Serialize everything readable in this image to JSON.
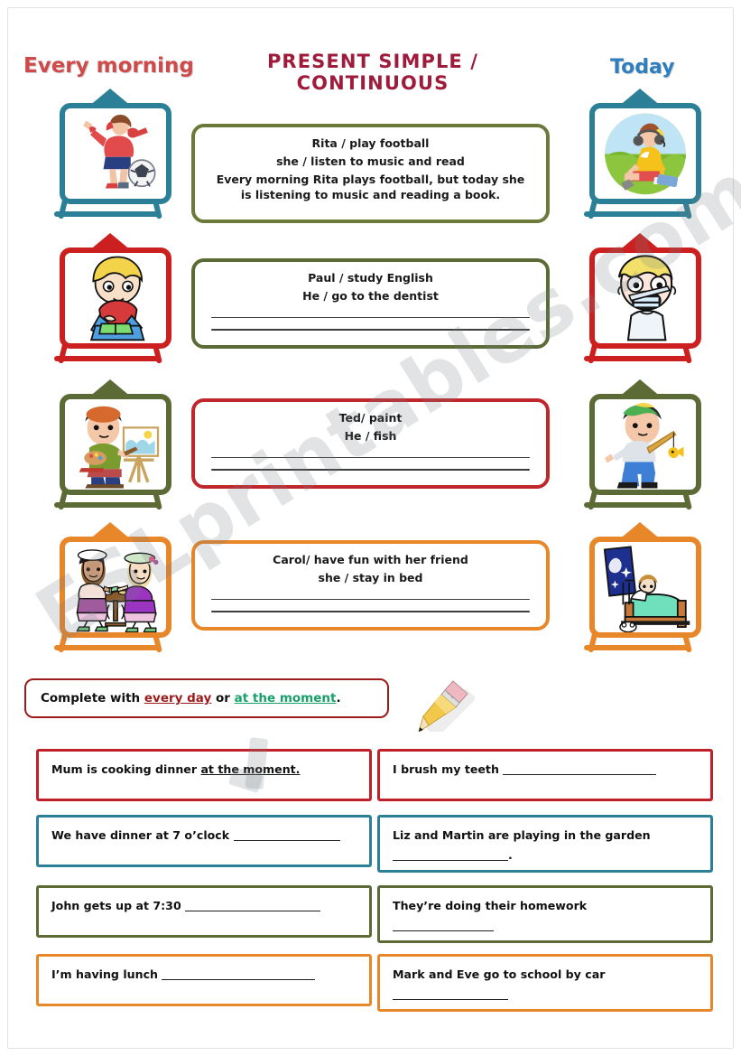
{
  "header": {
    "title_line1": "PRESENT SIMPLE /",
    "title_line2": "CONTINUOUS",
    "title_color": "#9e1b3c",
    "left_label": "Every morning",
    "left_label_color": "#cf4b4b",
    "right_label": "Today",
    "right_label_color": "#2f7fbf"
  },
  "watermark": {
    "text": "ESLprintables.com"
  },
  "rows": [
    {
      "frame_color": "#2b7f96",
      "left_picture": "girl-playing-football-icon",
      "right_picture": "girl-listening-music-reading-icon",
      "box_color": "#6b7a3a",
      "prompt_line1": "Rita / play football",
      "prompt_line2": "she / listen to music and read",
      "answer_line1": "Every morning Rita plays football, but today she",
      "answer_line2": "is listening to music and reading a book.",
      "blank_lines": 0
    },
    {
      "frame_color": "#cc2020",
      "left_picture": "boy-reading-book-icon",
      "right_picture": "boy-at-dentist-icon",
      "box_color": "#5c6b36",
      "prompt_line1": "Paul / study English",
      "prompt_line2": "He / go to the dentist",
      "answer_line1": "",
      "answer_line2": "",
      "blank_lines": 2
    },
    {
      "frame_color": "#5c6b36",
      "left_picture": "boy-painting-easel-icon",
      "right_picture": "boy-fishing-icon",
      "box_color": "#c0272d",
      "prompt_line1": "Ted/ paint",
      "prompt_line2": "He / fish",
      "answer_line1": "",
      "answer_line2": "",
      "blank_lines": 2
    },
    {
      "frame_color": "#e8862a",
      "left_picture": "two-girls-tea-party-icon",
      "right_picture": "girl-staying-in-bed-icon",
      "box_color": "#e8862a",
      "prompt_line1": "Carol/ have fun with her friend",
      "prompt_line2": "she / stay in bed",
      "answer_line1": "",
      "answer_line2": "",
      "blank_lines": 2
    }
  ],
  "instruction": {
    "prefix": "Complete with ",
    "option_one": "every day",
    "middle": " or ",
    "option_two": "at the moment",
    "suffix": ".",
    "option_one_color": "#9e1b1b",
    "option_two_color": "#18a06a",
    "pencil_icon": "pencil-icon"
  },
  "exercises": {
    "left": [
      {
        "border_color": "#c0202a",
        "text": "Mum is cooking dinner ",
        "answer": "at the moment.",
        "has_inline_blank": false,
        "has_second_line": false
      },
      {
        "border_color": "#2b7f96",
        "text": "We have dinner at 7 o’clock ",
        "answer": "",
        "has_inline_blank": true,
        "has_second_line": false
      },
      {
        "border_color": "#5c6b36",
        "text": "John gets up at 7:30 ",
        "answer": "",
        "has_inline_blank": true,
        "has_second_line": false
      },
      {
        "border_color": "#e8862a",
        "text": "I’m having lunch ",
        "answer": "",
        "has_inline_blank": true,
        "has_second_line": false
      }
    ],
    "right": [
      {
        "border_color": "#c0202a",
        "text": "I brush my teeth ",
        "answer": "",
        "has_inline_blank": true,
        "has_second_line": false
      },
      {
        "border_color": "#2b7f96",
        "text": "Liz and Martin are playing in the garden",
        "answer": "",
        "has_inline_blank": false,
        "has_second_line": true,
        "second_line_suffix": "."
      },
      {
        "border_color": "#5c6b36",
        "text": "They’re doing their homework",
        "answer": "",
        "has_inline_blank": false,
        "has_second_line": true,
        "second_line_suffix": ""
      },
      {
        "border_color": "#e8862a",
        "text": "Mark and Eve go to school by car",
        "answer": "",
        "has_inline_blank": false,
        "has_second_line": true,
        "second_line_suffix": ""
      }
    ]
  }
}
